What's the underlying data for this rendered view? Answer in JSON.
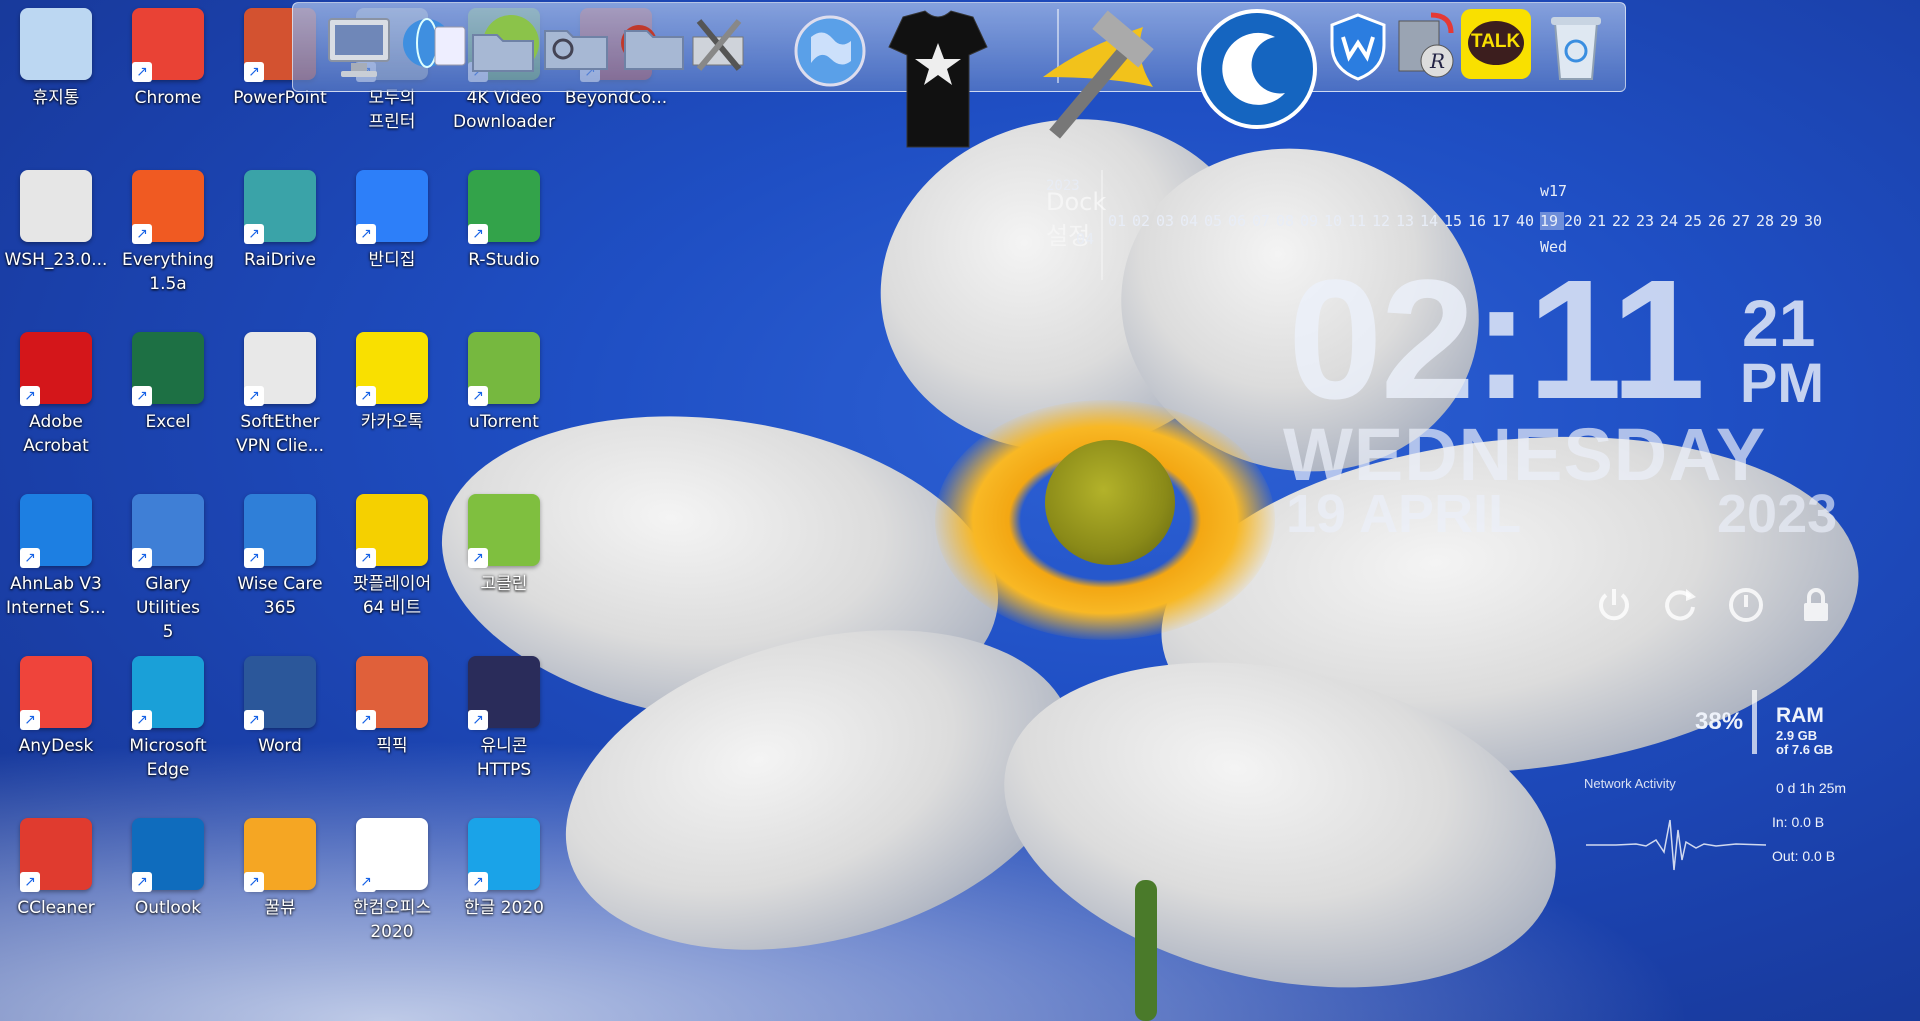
{
  "desktop_icons": [
    {
      "label": "휴지통",
      "shortcut": false,
      "icon": "recycle-bin-icon",
      "color": "#bcd7f2"
    },
    {
      "label": "Chrome",
      "shortcut": true,
      "icon": "chrome-icon",
      "color": "#e94235"
    },
    {
      "label": "PowerPoint",
      "shortcut": true,
      "icon": "powerpoint-icon",
      "color": "#d35230"
    },
    {
      "label": "모두의\n프린터",
      "shortcut": true,
      "icon": "printer-icon",
      "color": "#9aa7b8"
    },
    {
      "label": "4K Video\nDownloader",
      "shortcut": true,
      "icon": "video-downloader-icon",
      "color": "#6ab04c"
    },
    {
      "label": "BeyondCo...",
      "shortcut": true,
      "icon": "beyond-compare-icon",
      "color": "#c0392b"
    },
    {
      "label": "WSH_23.0...",
      "shortcut": false,
      "icon": "installer-icon",
      "color": "#e6e6e6"
    },
    {
      "label": "Everything\n1.5a",
      "shortcut": true,
      "icon": "everything-search-icon",
      "color": "#f05a22"
    },
    {
      "label": "RaiDrive",
      "shortcut": true,
      "icon": "raidrive-icon",
      "color": "#3aa3a8"
    },
    {
      "label": "반디집",
      "shortcut": true,
      "icon": "bandizip-icon",
      "color": "#2d7ff9"
    },
    {
      "label": "R-Studio",
      "shortcut": true,
      "icon": "r-studio-icon",
      "color": "#33a34a"
    },
    {
      "label": "Adobe\nAcrobat",
      "shortcut": true,
      "icon": "acrobat-icon",
      "color": "#d4161a"
    },
    {
      "label": "Excel",
      "shortcut": true,
      "icon": "excel-icon",
      "color": "#1d7044"
    },
    {
      "label": "SoftEther\nVPN Clie...",
      "shortcut": true,
      "icon": "softether-vpn-icon",
      "color": "#e8e8e8"
    },
    {
      "label": "카카오톡",
      "shortcut": true,
      "icon": "kakaotalk-icon",
      "color": "#f9e000"
    },
    {
      "label": "uTorrent",
      "shortcut": true,
      "icon": "utorrent-icon",
      "color": "#76b83f"
    },
    {
      "label": "AhnLab V3\nInternet S...",
      "shortcut": true,
      "icon": "ahnlab-v3-icon",
      "color": "#1d7fe2"
    },
    {
      "label": "Glary Utilities\n5",
      "shortcut": true,
      "icon": "glary-utilities-icon",
      "color": "#3f7fd6"
    },
    {
      "label": "Wise Care\n365",
      "shortcut": true,
      "icon": "wise-care-icon",
      "color": "#2f7fd8"
    },
    {
      "label": "팟플레이어\n64 비트",
      "shortcut": true,
      "icon": "potplayer-icon",
      "color": "#f5d000"
    },
    {
      "label": "고클린",
      "shortcut": true,
      "icon": "goclean-icon",
      "color": "#7fbf3f"
    },
    {
      "label": "AnyDesk",
      "shortcut": true,
      "icon": "anydesk-icon",
      "color": "#ef443b"
    },
    {
      "label": "Microsoft\nEdge",
      "shortcut": true,
      "icon": "edge-icon",
      "color": "#1aa0d8"
    },
    {
      "label": "Word",
      "shortcut": true,
      "icon": "word-icon",
      "color": "#2b579a"
    },
    {
      "label": "픽픽",
      "shortcut": true,
      "icon": "picpick-icon",
      "color": "#e0603a"
    },
    {
      "label": "유니콘\nHTTPS",
      "shortcut": true,
      "icon": "unicorn-https-icon",
      "color": "#2a2c5a"
    },
    {
      "label": "CCleaner",
      "shortcut": true,
      "icon": "ccleaner-icon",
      "color": "#e03b2f"
    },
    {
      "label": "Outlook",
      "shortcut": true,
      "icon": "outlook-icon",
      "color": "#0f6cbd"
    },
    {
      "label": "꿀뷰",
      "shortcut": true,
      "icon": "honeyview-icon",
      "color": "#f5a623"
    },
    {
      "label": "한컴오피스\n2020",
      "shortcut": true,
      "icon": "hancom-office-icon",
      "color": "#ffffff"
    },
    {
      "label": "한글 2020",
      "shortcut": true,
      "icon": "hangul-icon",
      "color": "#1aa3e8"
    }
  ],
  "dock": {
    "items": [
      {
        "icon": "monitor-icon"
      },
      {
        "icon": "network-globe-icon"
      },
      {
        "icon": "folder-icon"
      },
      {
        "icon": "folder-search-icon"
      },
      {
        "icon": "folder-settings-icon"
      },
      {
        "icon": "tools-icon"
      },
      {
        "icon": "globe-icon"
      },
      {
        "icon": "tshirt-icon"
      },
      {
        "icon": "hammer-icon"
      },
      {
        "icon": "glary-utilities-icon"
      },
      {
        "icon": "wise-care-icon"
      },
      {
        "icon": "registry-icon"
      },
      {
        "icon": "kakaotalk-icon"
      },
      {
        "icon": "recycle-bin-icon"
      }
    ],
    "kakao_label": "TALK"
  },
  "calendar": {
    "year": "2023",
    "title": "Dock 설정",
    "month": "04",
    "week": "w17",
    "days": [
      "01",
      "02",
      "03",
      "04",
      "05",
      "06",
      "07",
      "08",
      "09",
      "10",
      "11",
      "12",
      "13",
      "14",
      "15",
      "16",
      "17",
      "40",
      "19",
      "20",
      "21",
      "22",
      "23",
      "24",
      "25",
      "26",
      "27",
      "28",
      "29",
      "30"
    ],
    "today": "19",
    "dow": "Wed"
  },
  "clock": {
    "time": "02:11",
    "seconds": "21",
    "ampm": "PM",
    "weekday": "WEDNESDAY",
    "date": "19 APRIL",
    "year": "2023"
  },
  "power_buttons": [
    {
      "icon": "power-icon"
    },
    {
      "icon": "restart-icon"
    },
    {
      "icon": "sleep-icon"
    },
    {
      "icon": "lock-icon"
    }
  ],
  "sysmon": {
    "cpu": "38%",
    "ram_label": "RAM",
    "ram_used": "2.9 GB",
    "ram_total": "of 7.6 GB",
    "network_title": "Network Activity",
    "uptime": "0 d 1h 25m",
    "net_in": "In: 0.0 B",
    "net_out": "Out: 0.0 B"
  }
}
